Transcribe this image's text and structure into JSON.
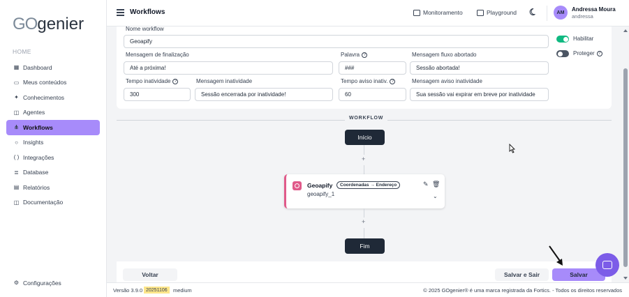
{
  "brand": {
    "logo_part1": "GO",
    "logo_part2": "genier"
  },
  "sidebar": {
    "section_label": "HOME",
    "items": [
      {
        "label": "Dashboard",
        "icon": "grid-icon"
      },
      {
        "label": "Meus conteúdos",
        "icon": "folder-icon"
      },
      {
        "label": "Conhecimentos",
        "icon": "sparkle-icon"
      },
      {
        "label": "Agentes",
        "icon": "robot-icon"
      },
      {
        "label": "Workflows",
        "icon": "workflow-icon",
        "active": true
      },
      {
        "label": "Insights",
        "icon": "lightbulb-icon"
      },
      {
        "label": "Integrações",
        "icon": "braces-icon"
      },
      {
        "label": "Database",
        "icon": "database-icon"
      },
      {
        "label": "Relatórios",
        "icon": "report-icon"
      },
      {
        "label": "Documentação",
        "icon": "book-icon"
      }
    ],
    "settings_label": "Configurações"
  },
  "topbar": {
    "title": "Workflows",
    "monitor_label": "Monitoramento",
    "playground_label": "Playground",
    "user": {
      "initials": "AM",
      "name": "Andressa Moura",
      "login": "andressa"
    }
  },
  "form": {
    "name_label": "Nome workflow",
    "name_value": "Geoapify",
    "enable_label": "Habilitar",
    "enable_on": true,
    "protect_label": "Proteger",
    "protect_on": false,
    "final_msg_label": "Mensagem de finalização",
    "final_msg_value": "Até a próxima!",
    "word_label": "Palavra",
    "word_value": "###",
    "abort_msg_label": "Mensagem fluxo abortado",
    "abort_msg_value": "Sessão abortada!",
    "idle_time_label": "Tempo inatividade",
    "idle_time_value": "300",
    "idle_msg_label": "Mensagem inatividade",
    "idle_msg_value": "Sessão encerrada por inatividade!",
    "warn_time_label": "Tempo aviso inativ.",
    "warn_time_value": "60",
    "warn_msg_label": "Mensagem aviso inatividade",
    "warn_msg_value": "Sua sessão vai expirar em breve por inatividade"
  },
  "workflow": {
    "section_title": "WORKFLOW",
    "start_label": "Início",
    "end_label": "Fim",
    "node": {
      "name": "Geoapify",
      "badge": "Coordenadas → Endereço",
      "id": "geoapify_1",
      "color": "#e05a8a"
    }
  },
  "actions": {
    "back_label": "Voltar",
    "save_exit_label": "Salvar e Sair",
    "save_label": "Salvar"
  },
  "footer": {
    "version": "Versão 3.9.0",
    "build": "20251106",
    "tier": "medium",
    "copyright": "© 2025 GOgenier® é uma marca registrada da Fortics. - Todos os direitos reservados"
  },
  "colors": {
    "accent": "#a78bfa",
    "toggle_on": "#10b981",
    "node_accent": "#e05a8a",
    "fab": "#7c5ce8"
  }
}
